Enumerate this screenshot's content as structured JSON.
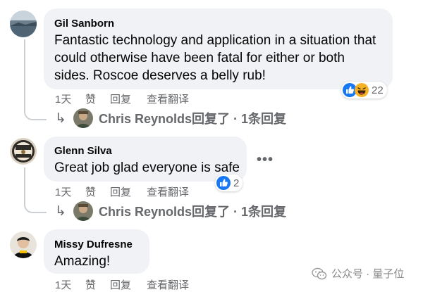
{
  "colors": {
    "bubble_bg": "#f0f2f5",
    "meta_text": "#65676b",
    "like_blue": "#1877f2",
    "haha_yellow": "#f7b125"
  },
  "comments": [
    {
      "author": "Gil Sanborn",
      "lines": [
        "Fantastic technology and application in a situation that",
        "could otherwise have been fatal for either or both",
        "sides. Roscoe deserves a belly rub!"
      ],
      "time": "1天",
      "like_label": "赞",
      "reply_label": "回复",
      "translate_label": "查看翻译",
      "reaction_icons": [
        "like-icon",
        "haha-icon"
      ],
      "reaction_count": "22",
      "reply_summary": "Chris Reynolds回复了 · 1条回复"
    },
    {
      "author": "Glenn Silva",
      "lines": [
        "Great job glad everyone is safe"
      ],
      "time": "1天",
      "like_label": "赞",
      "reply_label": "回复",
      "translate_label": "查看翻译",
      "reaction_icons": [
        "like-icon"
      ],
      "reaction_count": "2",
      "more_label": "•••",
      "reply_summary": "Chris Reynolds回复了 · 1条回复"
    },
    {
      "author": "Missy Dufresne",
      "lines": [
        "Amazing!"
      ],
      "time": "1天",
      "like_label": "赞",
      "reply_label": "回复",
      "translate_label": "查看翻译"
    }
  ],
  "reply_arrow": "↳",
  "watermark": {
    "icon": "wechat-icon",
    "text": "公众号 · 量子位"
  }
}
